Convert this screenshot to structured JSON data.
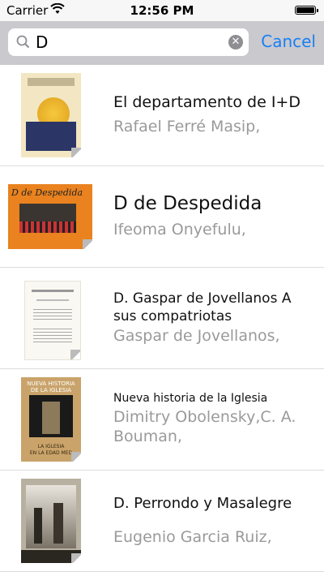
{
  "status": {
    "carrier": "Carrier",
    "time": "12:56 PM"
  },
  "search": {
    "value": "D",
    "cancel_label": "Cancel"
  },
  "books": [
    {
      "title": "El departamento de I+D",
      "author": "Rafael Ferré Masip,"
    },
    {
      "title": "D de Despedida",
      "author": "Ifeoma Onyefulu,"
    },
    {
      "title": "D. Gaspar de Jovellanos A sus compatriotas",
      "author": "Gaspar de Jovellanos,"
    },
    {
      "title": "Nueva historia de la Iglesia",
      "author": "Dimitry Obolensky,C. A. Bouman,"
    },
    {
      "title": "D. Perrondo y Masalegre",
      "author": "Eugenio Garcia Ruiz,"
    }
  ],
  "colors": {
    "accent": "#1a7ff5",
    "search_bar_bg": "#c9c9ce",
    "secondary_text": "#9a9a9a"
  }
}
